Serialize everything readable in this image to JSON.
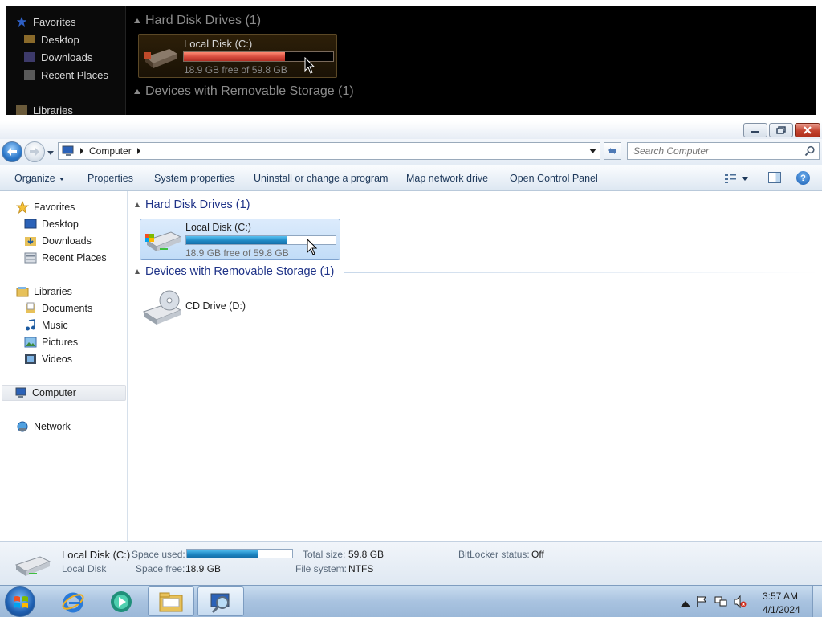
{
  "magnifier": {
    "nav": {
      "favorites": "Favorites",
      "desktop": "Desktop",
      "downloads": "Downloads",
      "recent_places": "Recent Places",
      "libraries": "Libraries"
    },
    "hard_disk_group": "Hard Disk Drives (1)",
    "removable_group": "Devices with Removable Storage (1)",
    "disk": {
      "name": "Local Disk (C:)",
      "free_text": "18.9 GB free of 59.8 GB",
      "used_fraction": 0.68
    },
    "colors": {
      "bar_fill": "#d54a3c"
    }
  },
  "window": {
    "address": {
      "crumb": "Computer"
    },
    "search": {
      "placeholder": "Search Computer"
    },
    "toolbar": {
      "organize": "Organize",
      "properties": "Properties",
      "system_properties": "System properties",
      "uninstall": "Uninstall or change a program",
      "map_drive": "Map network drive",
      "control_panel": "Open Control Panel"
    },
    "nav": {
      "favorites": "Favorites",
      "desktop": "Desktop",
      "downloads": "Downloads",
      "recent_places": "Recent Places",
      "libraries": "Libraries",
      "documents": "Documents",
      "music": "Music",
      "pictures": "Pictures",
      "videos": "Videos",
      "computer": "Computer",
      "network": "Network"
    },
    "groups": {
      "hard_disk": "Hard Disk Drives (1)",
      "removable": "Devices with Removable Storage (1)"
    },
    "drives": {
      "c": {
        "name": "Local Disk (C:)",
        "free_text": "18.9 GB free of 59.8 GB",
        "used_fraction": 0.68
      },
      "d": {
        "name": "CD Drive (D:)"
      }
    },
    "details": {
      "name": "Local Disk (C:)",
      "type": "Local Disk",
      "space_used_label": "Space used:",
      "space_used_fraction": 0.68,
      "space_free_label": "Space free:",
      "space_free_value": "18.9 GB",
      "total_size_label": "Total size:",
      "total_size_value": "59.8 GB",
      "file_system_label": "File system:",
      "file_system_value": "NTFS",
      "bitlocker_label": "BitLocker status:",
      "bitlocker_value": "Off"
    },
    "colors": {
      "bar_fill": "#1f89c5",
      "accent": "#1e3287"
    }
  },
  "taskbar": {
    "apps": [
      "start-orb",
      "internet-explorer",
      "media-player",
      "windows-explorer",
      "magnifier"
    ],
    "clock": {
      "time": "3:57 AM",
      "date": "4/1/2024"
    }
  }
}
